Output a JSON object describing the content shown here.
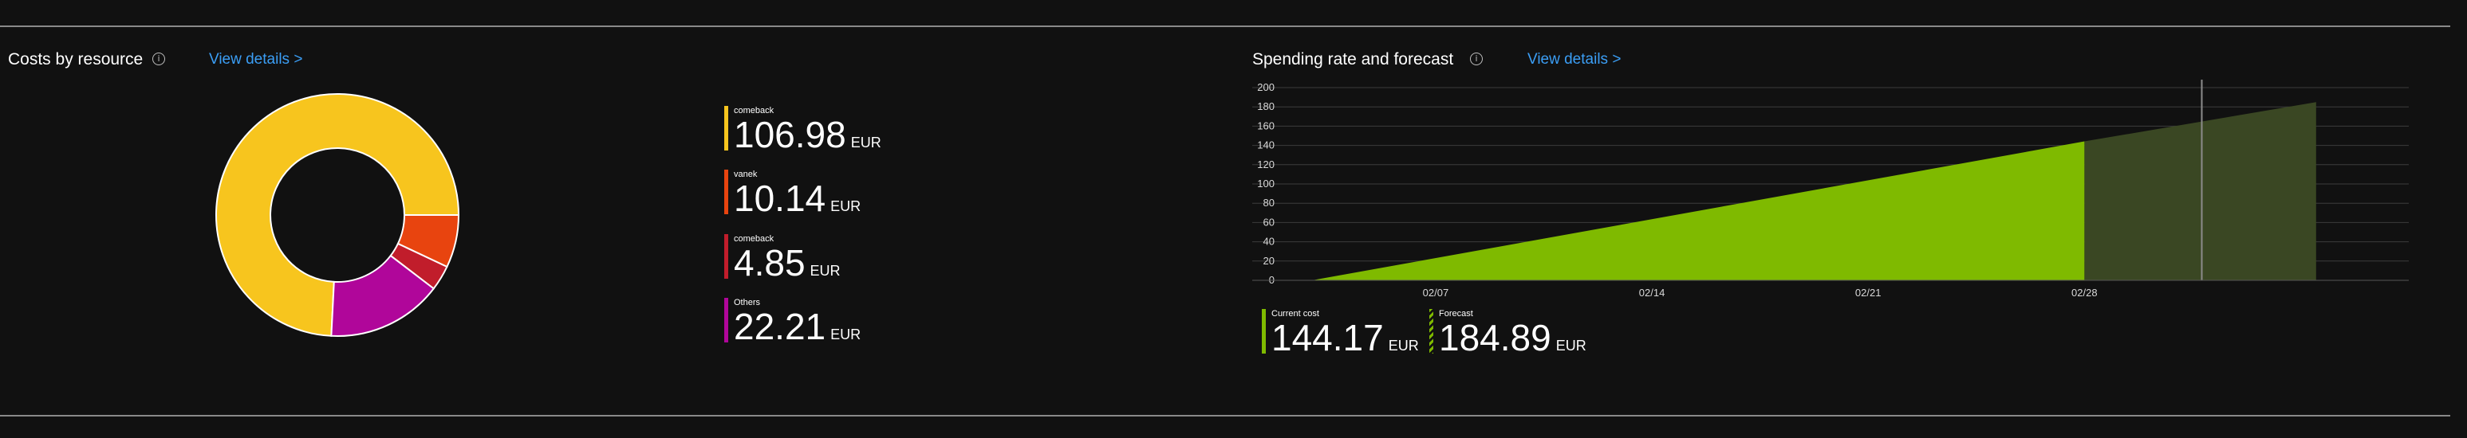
{
  "costs_panel": {
    "title": "Costs by resource",
    "info_icon": "info-icon",
    "link": "View details >",
    "legend_unit": "EUR"
  },
  "forecast_panel": {
    "title": "Spending rate and forecast",
    "info_icon": "info-icon",
    "link": "View details >",
    "current_label": "Current cost",
    "current_value": "144.17",
    "forecast_label": "Forecast",
    "forecast_value": "184.89",
    "unit": "EUR"
  },
  "chart_data": [
    {
      "type": "pie",
      "donut": true,
      "title": "Costs by resource",
      "categories": [
        "comeback",
        "vanek",
        "comeback",
        "Others"
      ],
      "values": [
        106.98,
        10.14,
        4.85,
        22.21
      ],
      "value_labels": [
        "106.98",
        "10.14",
        "4.85",
        "22.21"
      ],
      "unit": "EUR",
      "colors": [
        "#f7c51e",
        "#e8440f",
        "#c11d2b",
        "#b0069a"
      ],
      "legend": "right"
    },
    {
      "type": "area",
      "title": "Spending rate and forecast",
      "y_ticks": [
        0,
        20,
        40,
        60,
        80,
        100,
        120,
        140,
        160,
        180,
        200
      ],
      "ylim": [
        0,
        200
      ],
      "x_tick_labels": [
        "02/07",
        "02/14",
        "02/21",
        "02/28"
      ],
      "grid": true,
      "series": [
        {
          "name": "Current cost",
          "color": "#7fba00",
          "x": [
            0,
            25
          ],
          "values": [
            0,
            144.17
          ]
        },
        {
          "name": "Forecast",
          "color": "#3a4723",
          "x": [
            25,
            32.5
          ],
          "values": [
            144.17,
            184.89
          ]
        }
      ],
      "x_tick_positions": [
        4,
        11,
        18,
        25
      ],
      "today_x": 28.8
    }
  ]
}
